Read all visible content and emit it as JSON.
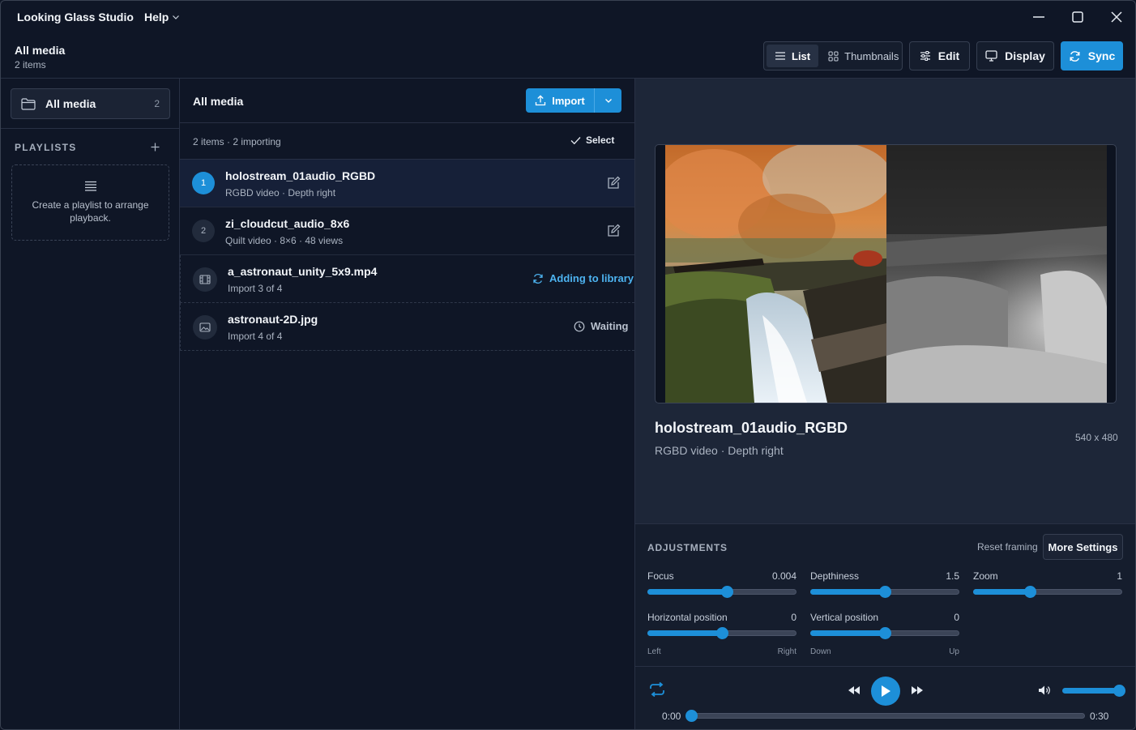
{
  "app": {
    "title": "Looking Glass Studio",
    "help_menu": "Help"
  },
  "header": {
    "title": "All media",
    "subtitle": "2 items",
    "view_list": "List",
    "view_thumbnails": "Thumbnails",
    "edit": "Edit",
    "display": "Display",
    "sync": "Sync"
  },
  "sidebar": {
    "all_media_label": "All media",
    "all_media_count": "2",
    "playlists_header": "PLAYLISTS",
    "playlist_empty": "Create a playlist to arrange playback."
  },
  "media": {
    "title": "All media",
    "import_label": "Import",
    "status": "2 items · 2 importing",
    "select_label": "Select",
    "items": [
      {
        "badge": "1",
        "name": "holostream_01audio_RGBD",
        "meta": "RGBD video · Depth right",
        "selected": true
      },
      {
        "badge": "2",
        "name": "zi_cloudcut_audio_8x6",
        "meta": "Quilt video · 8×6 · 48 views",
        "selected": false
      }
    ],
    "importing": [
      {
        "name": "a_astronaut_unity_5x9.mp4",
        "meta": "Import 3 of 4",
        "state": "Adding to library",
        "icon": "film-icon"
      },
      {
        "name": "astronaut-2D.jpg",
        "meta": "Import 4 of 4",
        "state": "Waiting",
        "icon": "image-icon"
      }
    ]
  },
  "preview": {
    "title": "holostream_01audio_RGBD",
    "meta": "RGBD video · Depth right",
    "resolution": "540 x 480"
  },
  "adjustments": {
    "header": "ADJUSTMENTS",
    "reset": "Reset framing",
    "more": "More Settings",
    "focus": {
      "label": "Focus",
      "value": "0.004",
      "fraction": 0.53
    },
    "depthiness": {
      "label": "Depthiness",
      "value": "1.5",
      "fraction": 0.5
    },
    "zoom": {
      "label": "Zoom",
      "value": "1",
      "fraction": 0.38
    },
    "horizontal": {
      "label": "Horizontal position",
      "value": "0",
      "fraction": 0.5,
      "left": "Left",
      "right": "Right"
    },
    "vertical": {
      "label": "Vertical position",
      "value": "0",
      "fraction": 0.5,
      "left": "Down",
      "right": "Up"
    }
  },
  "player": {
    "current_time": "0:00",
    "total_time": "0:30",
    "progress": 0.0,
    "volume": 1.0
  },
  "colors": {
    "accent": "#1d8fd8",
    "background": "#0f1626",
    "panel": "#1d2638"
  }
}
